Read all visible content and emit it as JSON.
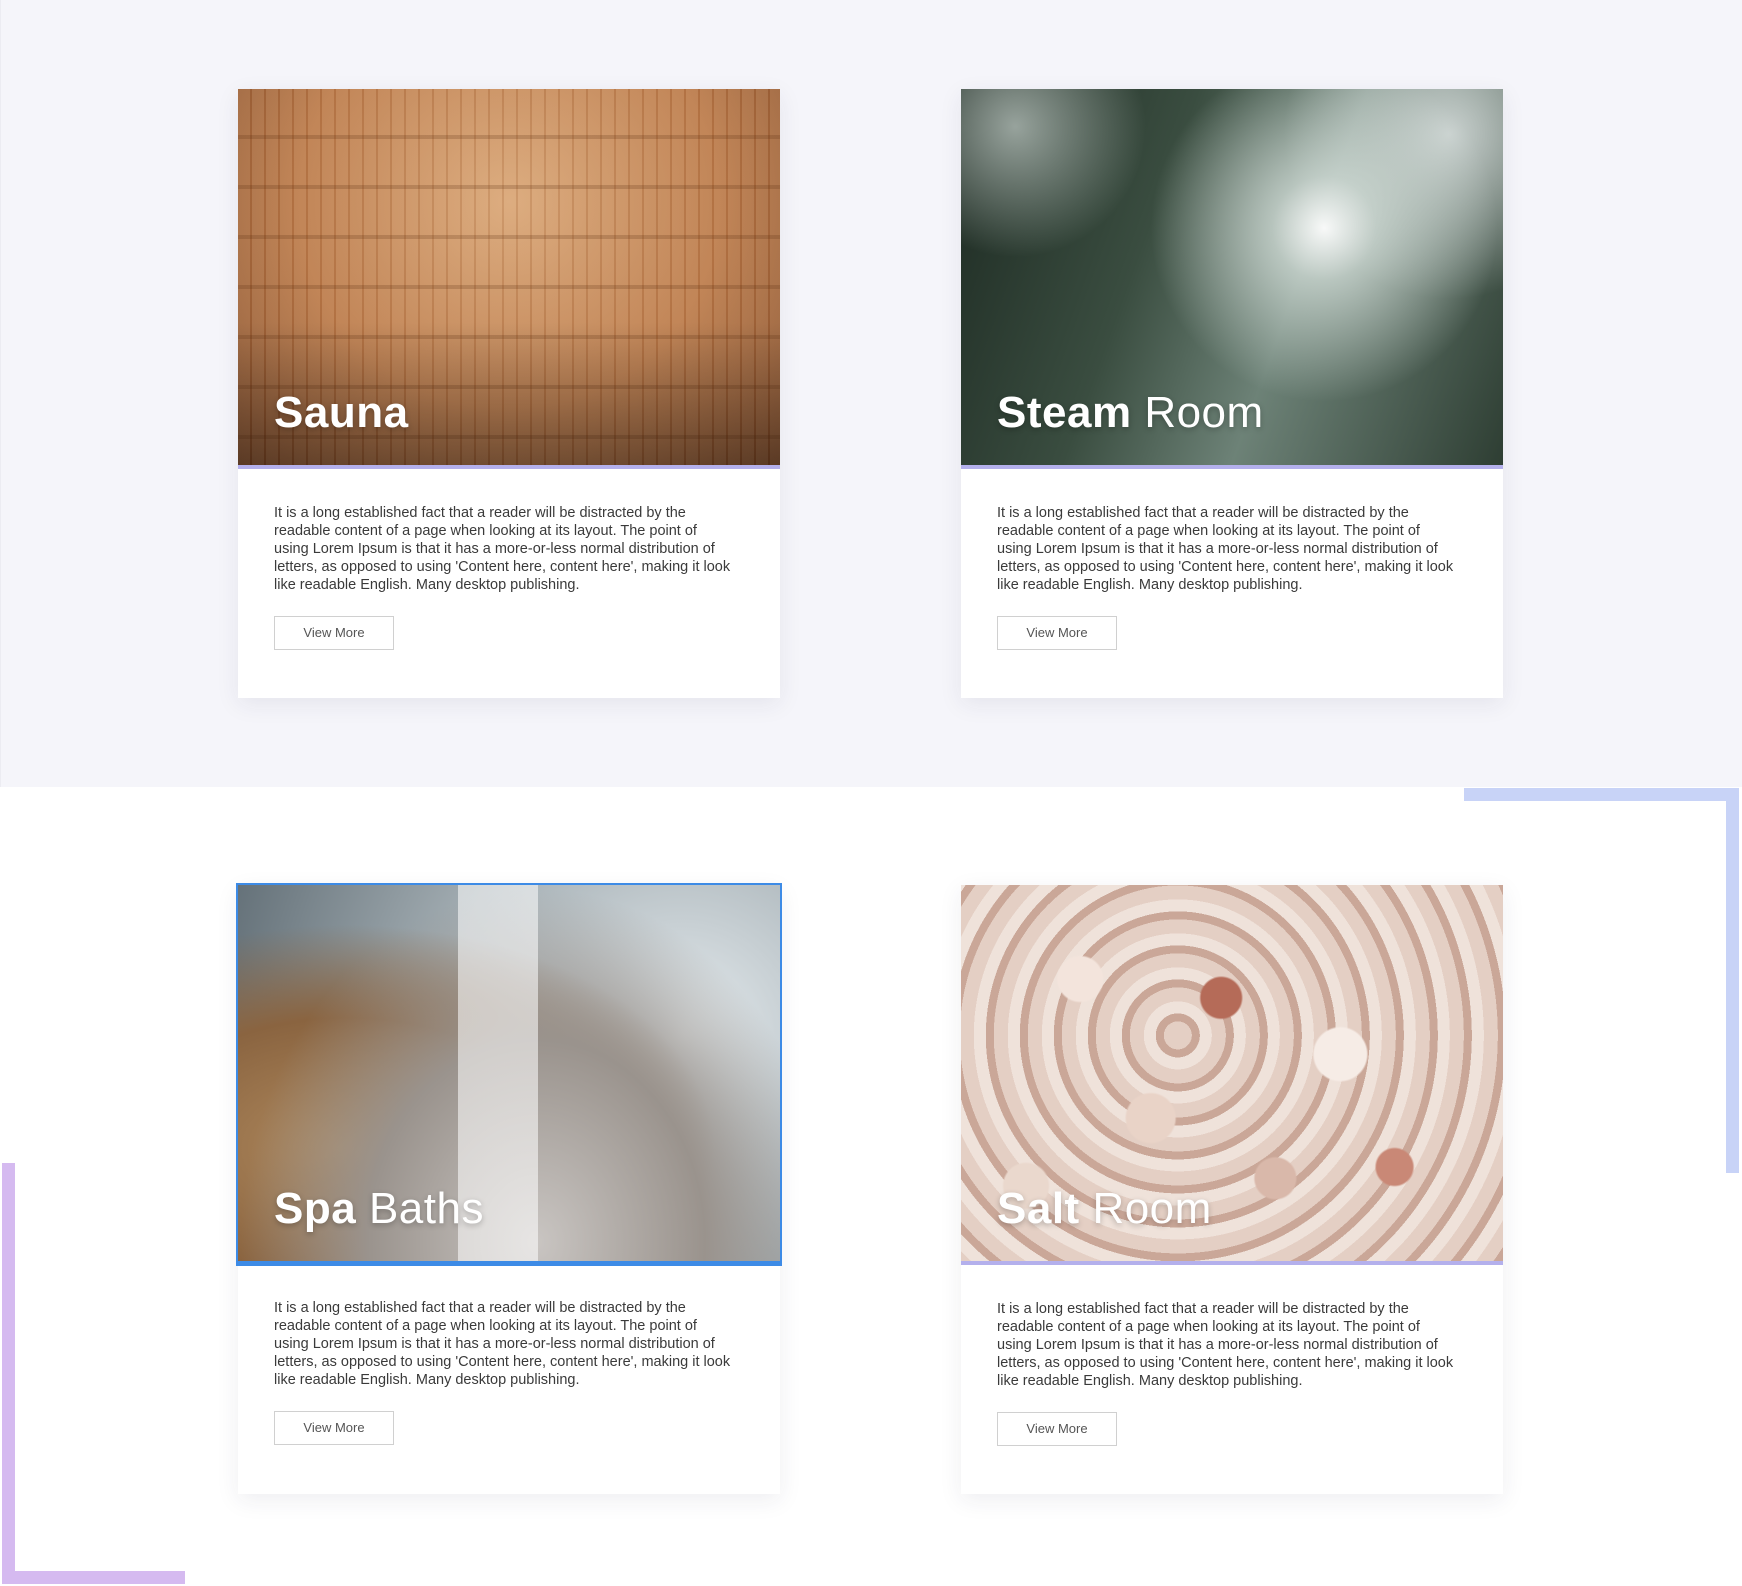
{
  "colors": {
    "top_bg": "#f5f5fa",
    "card_bg": "#ffffff",
    "media_underline": "#b4b0ec",
    "selected_outline": "#3d8be6",
    "deco_blue": "#c8d3f7",
    "deco_purple": "#d5baf0"
  },
  "cards": [
    {
      "title_bold": "Sauna",
      "title_light": "",
      "image": "sauna-photo",
      "text": "It is a long established fact that a reader will be distracted by the readable content of a page when looking at its layout. The point of using Lorem Ipsum is that it has a more-or-less normal distribution of letters, as opposed to using 'Content here, content here', making it look like readable English. Many desktop publishing.",
      "button_label": "View More"
    },
    {
      "title_bold": "Steam",
      "title_light": "Room",
      "image": "steam-photo",
      "text": "It is a long established fact that a reader will be distracted by the readable content of a page when looking at its layout. The point of using Lorem Ipsum is that it has a more-or-less normal distribution of letters, as opposed to using 'Content here, content here', making it look like readable English. Many desktop publishing.",
      "button_label": "View More"
    },
    {
      "title_bold": "Spa",
      "title_light": "Baths",
      "image": "spa-photo",
      "selected": true,
      "text": "It is a long established fact that a reader will be distracted by the readable content of a page when looking at its layout. The point of using Lorem Ipsum is that it has a more-or-less normal distribution of letters, as opposed to using 'Content here, content here', making it look like readable English. Many desktop publishing.",
      "button_label": "View More"
    },
    {
      "title_bold": "Salt",
      "title_light": "Room",
      "image": "salt-photo",
      "text": "It is a long established fact that a reader will be distracted by the readable content of a page when looking at its layout. The point of using Lorem Ipsum is that it has a more-or-less normal distribution of letters, as opposed to using 'Content here, content here', making it look like readable English. Many desktop publishing.",
      "button_label": "View More"
    }
  ]
}
